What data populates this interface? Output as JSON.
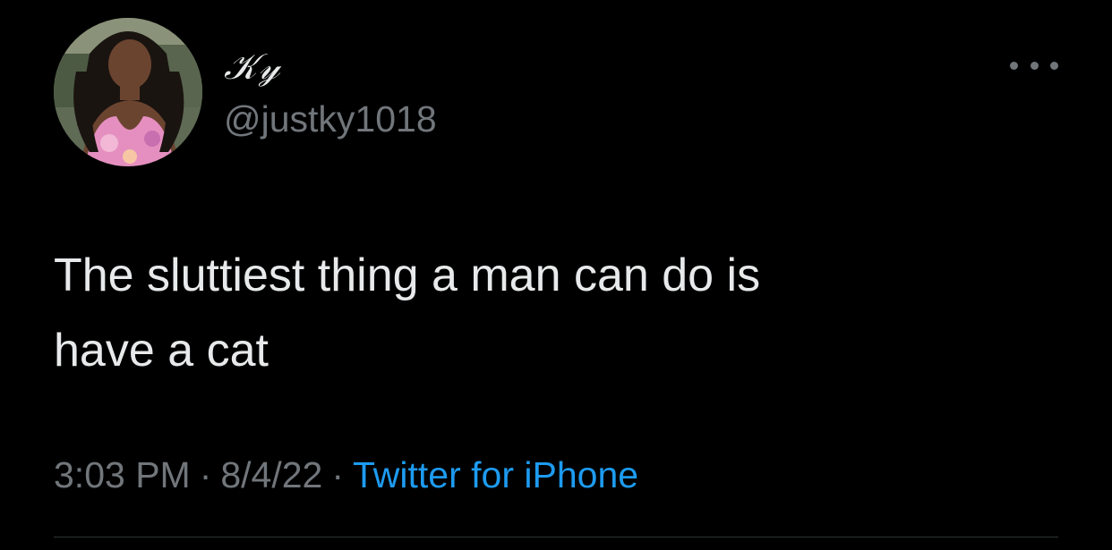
{
  "tweet": {
    "display_name": "𝒦𝓎",
    "handle": "@justky1018",
    "text_line1": "The sluttiest thing a man can do is",
    "text_line2": "have a cat",
    "time": "3:03 PM",
    "date": "8/4/22",
    "source": "Twitter for iPhone",
    "separator": "·"
  },
  "icons": {
    "more": "more-horizontal-icon",
    "avatar": "profile-avatar"
  },
  "colors": {
    "background": "#000000",
    "text": "#e7e9ea",
    "muted": "#71767b",
    "link": "#1d9bf0",
    "divider": "#2f3336"
  }
}
